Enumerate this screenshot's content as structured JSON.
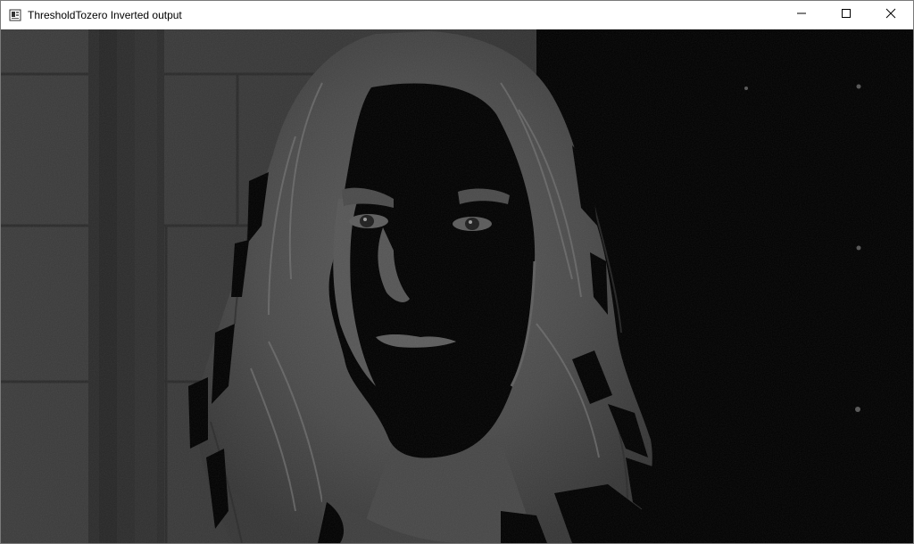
{
  "window": {
    "title": "ThresholdTozero Inverted output",
    "icon": "app-window-icon",
    "controls": {
      "minimize_icon": "minimize-icon",
      "maximize_icon": "maximize-icon",
      "close_icon": "close-icon"
    }
  },
  "image": {
    "description_icon": "thresholded-portrait-image",
    "palette": {
      "background_dark": "#000000",
      "left_wall": "#3a3a3a",
      "left_wall_light": "#464646",
      "pillar": "#2e2e2e",
      "hair": "#4a4a4a",
      "hair_light": "#6a6a6a",
      "skin_edge": "#5a5a5a",
      "face": "#000000"
    }
  }
}
